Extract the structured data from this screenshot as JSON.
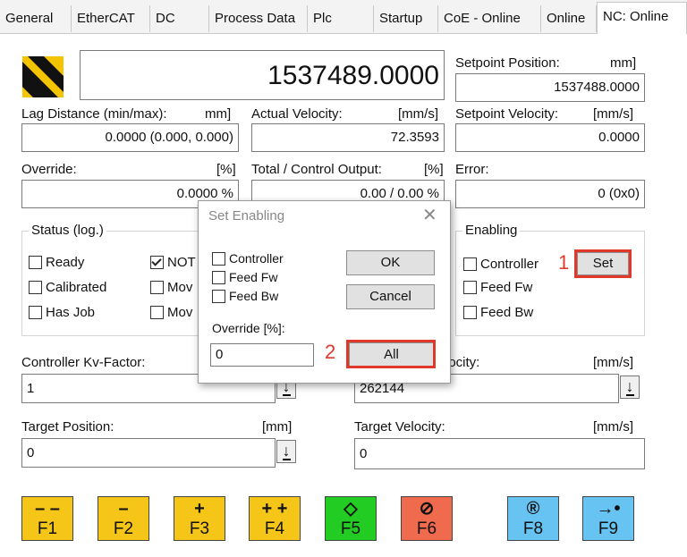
{
  "tabs": [
    "General",
    "EtherCAT",
    "DC",
    "Process Data",
    "Plc",
    "Startup",
    "CoE - Online",
    "Online",
    "NC: Online"
  ],
  "main": {
    "actual_position": "1537489.0000",
    "setpoint_position": {
      "label": "Setpoint Position:",
      "unit": "mm]",
      "value": "1537488.0000"
    },
    "lag_distance": {
      "label": "Lag Distance (min/max):",
      "unit": "mm]",
      "value": "0.0000  (0.000, 0.000)"
    },
    "actual_velocity": {
      "label": "Actual Velocity:",
      "unit": "[mm/s]",
      "value": "72.3593"
    },
    "setpoint_velocity": {
      "label": "Setpoint Velocity:",
      "unit": "[mm/s]",
      "value": "0.0000"
    },
    "override": {
      "label": "Override:",
      "unit": "[%]",
      "value": "0.0000 %"
    },
    "total_output": {
      "label": "Total / Control Output:",
      "unit": "[%]",
      "value": "0.00 /  0.00 %"
    },
    "error": {
      "label": "Error:",
      "value": "0 (0x0)"
    },
    "status": {
      "title": "Status (log.)",
      "items": [
        {
          "label": "Ready",
          "checked": false
        },
        {
          "label": "Calibrated",
          "checked": false
        },
        {
          "label": "Has Job",
          "checked": false
        }
      ],
      "items2": [
        {
          "label": "NOT",
          "checked": true
        },
        {
          "label": "Mov",
          "checked": false
        },
        {
          "label": "Mov",
          "checked": false
        }
      ]
    },
    "enabling": {
      "title": "Enabling",
      "items": [
        {
          "label": "Controller",
          "checked": false
        },
        {
          "label": "Feed Fw",
          "checked": false
        },
        {
          "label": "Feed Bw",
          "checked": false
        }
      ],
      "set_label": "Set"
    },
    "kv_factor": {
      "label": "Controller Kv-Factor:",
      "value": "1"
    },
    "ref_velocity": {
      "label": "locity:",
      "unit": "[mm/s]",
      "value": "262144"
    },
    "target_position": {
      "label": "Target Position:",
      "unit": "[mm]",
      "value": "0"
    },
    "target_velocity": {
      "label": "Target Velocity:",
      "unit": "[mm/s]",
      "value": "0"
    }
  },
  "fkeys": [
    {
      "name": "F1",
      "sym": "– –",
      "color": "#f5c518"
    },
    {
      "name": "F2",
      "sym": "–",
      "color": "#f5c518"
    },
    {
      "name": "F3",
      "sym": "+",
      "color": "#f5c518"
    },
    {
      "name": "F4",
      "sym": "+ +",
      "color": "#f5c518"
    },
    {
      "name": "F5",
      "sym": "◇",
      "color": "#22cc22"
    },
    {
      "name": "F6",
      "sym": "⊘",
      "color": "#f06a4d"
    },
    {
      "name": "F8",
      "sym": "®",
      "color": "#66c3f2"
    },
    {
      "name": "F9",
      "sym": "→•",
      "color": "#66c3f2"
    }
  ],
  "dialog": {
    "title": "Set Enabling",
    "checks": [
      {
        "label": "Controller",
        "checked": false
      },
      {
        "label": "Feed Fw",
        "checked": false
      },
      {
        "label": "Feed Bw",
        "checked": false
      }
    ],
    "ok_label": "OK",
    "cancel_label": "Cancel",
    "override_label": "Override [%]:",
    "override_value": "0",
    "all_label": "All"
  },
  "annotations": {
    "step1": "1",
    "step2": "2",
    "color": "#e0392b"
  }
}
